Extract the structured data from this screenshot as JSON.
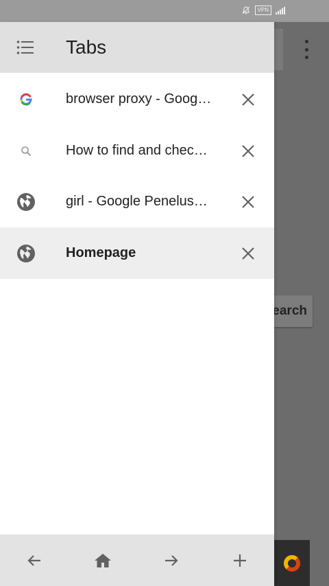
{
  "status_bar": {
    "vpn_label": "VPN",
    "icons": [
      "bell-muted-icon",
      "vpn-icon",
      "signal-icon"
    ]
  },
  "drawer": {
    "title": "Tabs",
    "menu_icon": "list-icon",
    "tabs": [
      {
        "title": "browser proxy - Google Search",
        "icon": "google-g-icon",
        "active": false
      },
      {
        "title": "How to find and check your proxy",
        "icon": "search-icon",
        "active": false
      },
      {
        "title": "girl - Google Penelusuran",
        "icon": "globe-icon",
        "active": false
      },
      {
        "title": "Homepage",
        "icon": "globe-icon",
        "active": true
      }
    ],
    "close_icon": "close-icon"
  },
  "bottom_toolbar": {
    "buttons": [
      "back-arrow-icon",
      "home-icon",
      "forward-arrow-icon",
      "plus-icon"
    ]
  },
  "background_page": {
    "search_button_text": "Search"
  },
  "colors": {
    "header_bg": "#e0e0e0",
    "active_tab_bg": "#eeeeee",
    "toolbar_bg": "#e3e3e3",
    "scrim": "#6c6c6c",
    "icon_gray": "#616161"
  }
}
